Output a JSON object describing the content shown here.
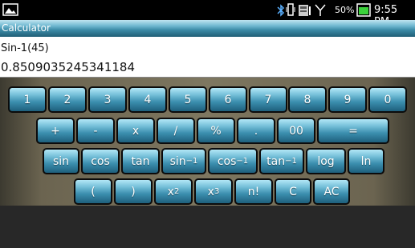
{
  "status_bar": {
    "battery": "50%",
    "time": "9:55 PM"
  },
  "app": {
    "title": "Calculator"
  },
  "display": {
    "expression": "Sin-1(45)",
    "result": "0.8509035245341184"
  },
  "keys": {
    "row1": [
      "1",
      "2",
      "3",
      "4",
      "5",
      "6",
      "7",
      "8",
      "9",
      "0"
    ],
    "row2": [
      "+",
      "-",
      "x",
      "/",
      "%",
      ".",
      "00",
      "="
    ],
    "row3": {
      "sin": "sin",
      "cos": "cos",
      "tan": "tan",
      "sin_inv": "sin",
      "cos_inv": "cos",
      "tan_inv": "tan",
      "inv_sup": "−1",
      "log": "log",
      "ln": "ln"
    },
    "row4": {
      "open_paren": "(",
      "close_paren": ")",
      "x_sq": "x",
      "sq_sup": "2",
      "x_cube": "x",
      "cube_sup": "3",
      "factorial": "n!",
      "clear": "C",
      "all_clear": "AC"
    }
  }
}
